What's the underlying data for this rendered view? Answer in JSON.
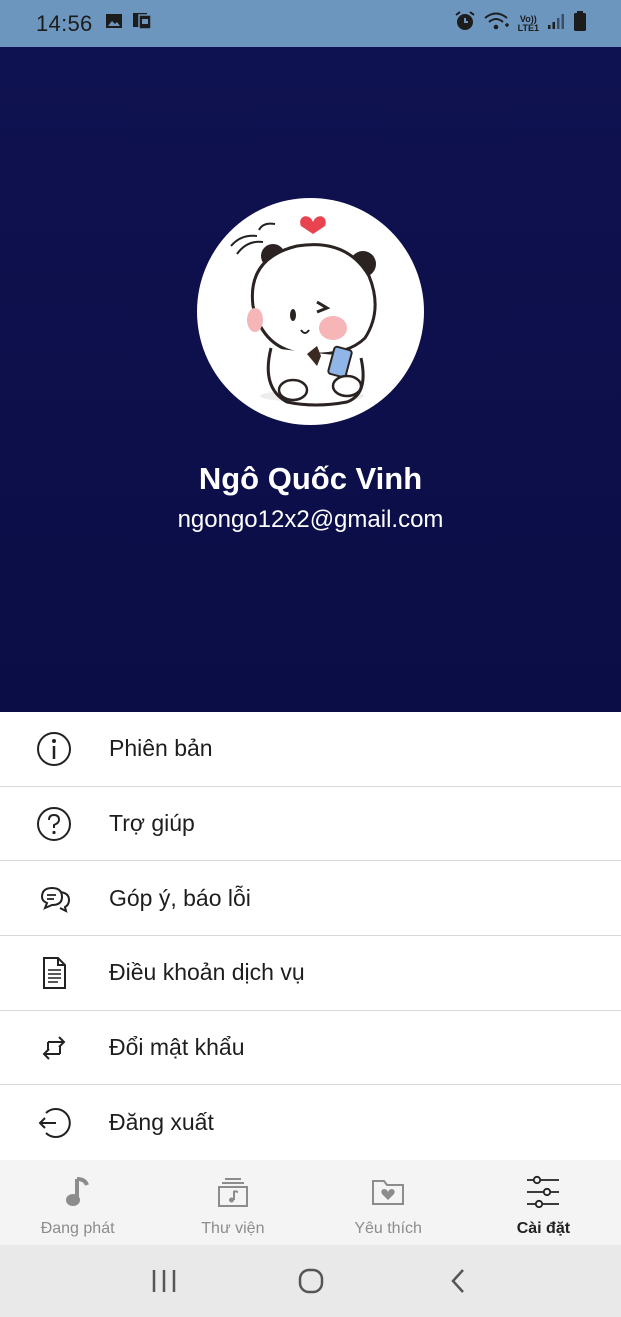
{
  "status_bar": {
    "time": "14:56",
    "network_label_top": "Vo))",
    "network_label_bottom": "LTE1",
    "icons": [
      "gallery-icon",
      "sim-icon",
      "alarm-icon",
      "wifi-icon",
      "signal-icon",
      "battery-icon"
    ]
  },
  "profile": {
    "name": "Ngô Quốc Vinh",
    "email": "ngongo12x2@gmail.com",
    "header_color": "#0d1049"
  },
  "menu": {
    "items": [
      {
        "label": "Phiên bản",
        "icon": "info-icon"
      },
      {
        "label": "Trợ giúp",
        "icon": "help-icon"
      },
      {
        "label": "Góp ý, báo lỗi",
        "icon": "feedback-icon"
      },
      {
        "label": "Điều khoản dịch vụ",
        "icon": "document-icon"
      },
      {
        "label": "Đổi mật khẩu",
        "icon": "swap-icon"
      },
      {
        "label": "Đăng xuất",
        "icon": "logout-icon"
      }
    ]
  },
  "bottom_nav": {
    "tabs": [
      {
        "label": "Đang phát",
        "icon": "music-note-icon",
        "active": false
      },
      {
        "label": "Thư viện",
        "icon": "library-icon",
        "active": false
      },
      {
        "label": "Yêu thích",
        "icon": "favorite-folder-icon",
        "active": false
      },
      {
        "label": "Cài đặt",
        "icon": "settings-sliders-icon",
        "active": true
      }
    ]
  },
  "system_nav": {
    "icons": [
      "recent-apps-icon",
      "home-icon",
      "back-icon"
    ]
  }
}
